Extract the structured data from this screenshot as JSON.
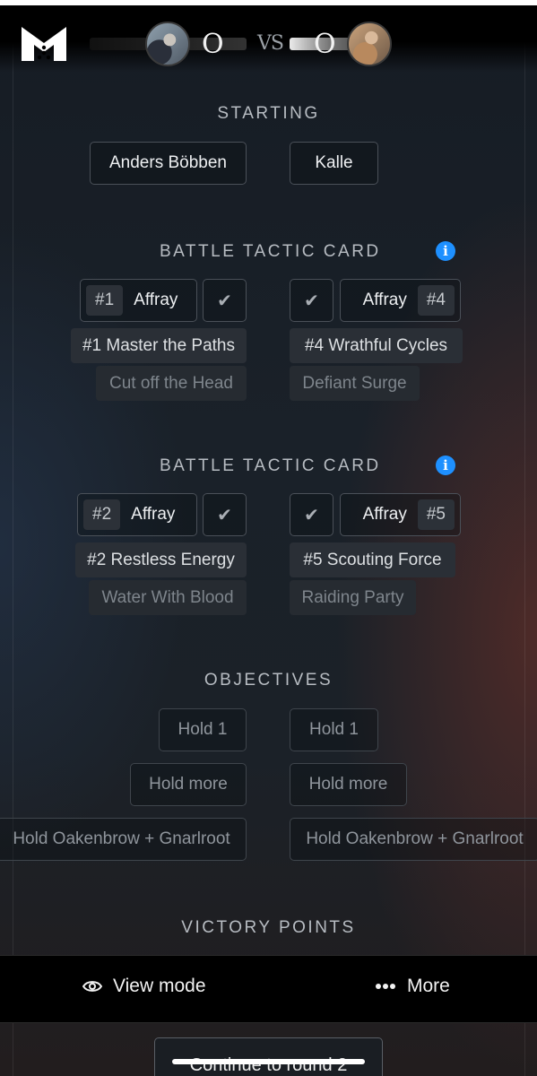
{
  "header": {
    "player_left_score": "O",
    "vs_label": "VS",
    "player_right_score": "O",
    "icons": {
      "logo": "m-logo-icon",
      "avatar_left": "player-avatar",
      "avatar_right": "player-avatar"
    }
  },
  "starting": {
    "title": "STARTING",
    "left_player": "Anders Böbben",
    "right_player": "Kalle"
  },
  "tactic1": {
    "title": "BATTLE TACTIC CARD",
    "info_icon": "i",
    "left": {
      "num": "#1",
      "label": "Affray",
      "check": "✔",
      "chosen": "#1 Master the Paths",
      "alt": "Cut off the Head"
    },
    "right": {
      "num": "#4",
      "label": "Affray",
      "check": "✔",
      "chosen": "#4 Wrathful Cycles",
      "alt": "Defiant Surge"
    }
  },
  "tactic2": {
    "title": "BATTLE TACTIC CARD",
    "info_icon": "i",
    "left": {
      "num": "#2",
      "label": "Affray",
      "check": "✔",
      "chosen": "#2 Restless Energy",
      "alt": "Water With Blood"
    },
    "right": {
      "num": "#5",
      "label": "Affray",
      "check": "✔",
      "chosen": "#5 Scouting Force",
      "alt": "Raiding Party"
    }
  },
  "objectives": {
    "title": "OBJECTIVES",
    "left": [
      "Hold 1",
      "Hold more",
      "Hold Oakenbrow + Gnarlroot"
    ],
    "right": [
      "Hold 1",
      "Hold more",
      "Hold Oakenbrow + Gnarlroot"
    ]
  },
  "victory": {
    "title": "VICTORY POINTS"
  },
  "bottom_bar": {
    "view_mode_label": "View mode",
    "more_label": "More",
    "view_icon": "eye-icon",
    "more_icon": "ellipsis-icon"
  },
  "continue_label": "Continue to round 2",
  "colors": {
    "accent_info": "#1e90ff",
    "background": "#1a2129"
  }
}
